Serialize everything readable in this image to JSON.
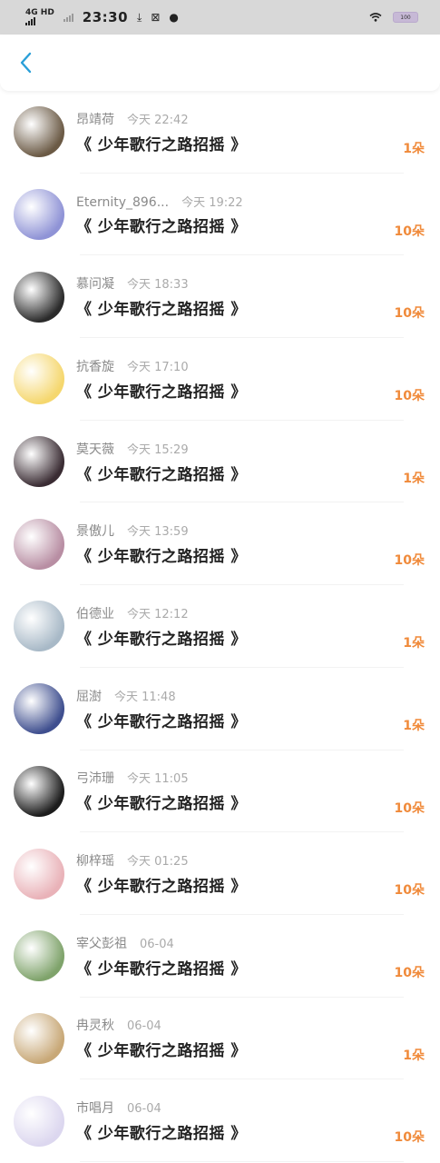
{
  "statusbar": {
    "network": "4G HD",
    "time": "23:30",
    "download_icon": "download-icon",
    "screenshot_icon": "screenshot-icon",
    "qq_icon": "qq-icon",
    "battery_text": "100"
  },
  "header": {
    "back_icon": "chevron-left-icon",
    "accent": "#2a9fd8"
  },
  "colors": {
    "amount": "#f08a3a",
    "title": "#222222",
    "meta": "#8a8a8a"
  },
  "items": [
    {
      "user": "昂靖荷",
      "time": "今天 22:42",
      "title": "《 少年歌行之路招摇 》",
      "amount": "1朵",
      "avatar_color": "#6b5a45"
    },
    {
      "user": "Eternity_896...",
      "time": "今天 19:22",
      "title": "《 少年歌行之路招摇 》",
      "amount": "10朵",
      "avatar_color": "#8f93d6"
    },
    {
      "user": "慕问凝",
      "time": "今天 18:33",
      "title": "《 少年歌行之路招摇 》",
      "amount": "10朵",
      "avatar_color": "#2b2b2b"
    },
    {
      "user": "抗香旋",
      "time": "今天 17:10",
      "title": "《 少年歌行之路招摇 》",
      "amount": "10朵",
      "avatar_color": "#f5d76e"
    },
    {
      "user": "莫天薇",
      "time": "今天 15:29",
      "title": "《 少年歌行之路招摇 》",
      "amount": "1朵",
      "avatar_color": "#3a2c33"
    },
    {
      "user": "景傲儿",
      "time": "今天 13:59",
      "title": "《 少年歌行之路招摇 》",
      "amount": "10朵",
      "avatar_color": "#b88ea3"
    },
    {
      "user": "伯德业",
      "time": "今天 12:12",
      "title": "《 少年歌行之路招摇 》",
      "amount": "1朵",
      "avatar_color": "#a8b9c7"
    },
    {
      "user": "屈澍",
      "time": "今天 11:48",
      "title": "《 少年歌行之路招摇 》",
      "amount": "1朵",
      "avatar_color": "#3f4f8f"
    },
    {
      "user": "弓沛珊",
      "time": "今天 11:05",
      "title": "《 少年歌行之路招摇 》",
      "amount": "10朵",
      "avatar_color": "#1c1c1c"
    },
    {
      "user": "柳梓瑶",
      "time": "今天 01:25",
      "title": "《 少年歌行之路招摇 》",
      "amount": "10朵",
      "avatar_color": "#e9b2b8"
    },
    {
      "user": "宰父彭祖",
      "time": "06-04",
      "title": "《 少年歌行之路招摇 》",
      "amount": "10朵",
      "avatar_color": "#7fa36b"
    },
    {
      "user": "冉灵秋",
      "time": "06-04",
      "title": "《 少年歌行之路招摇 》",
      "amount": "1朵",
      "avatar_color": "#c8a877"
    },
    {
      "user": "市唱月",
      "time": "06-04",
      "title": "《 少年歌行之路招摇 》",
      "amount": "10朵",
      "avatar_color": "#dcd7ef"
    }
  ]
}
